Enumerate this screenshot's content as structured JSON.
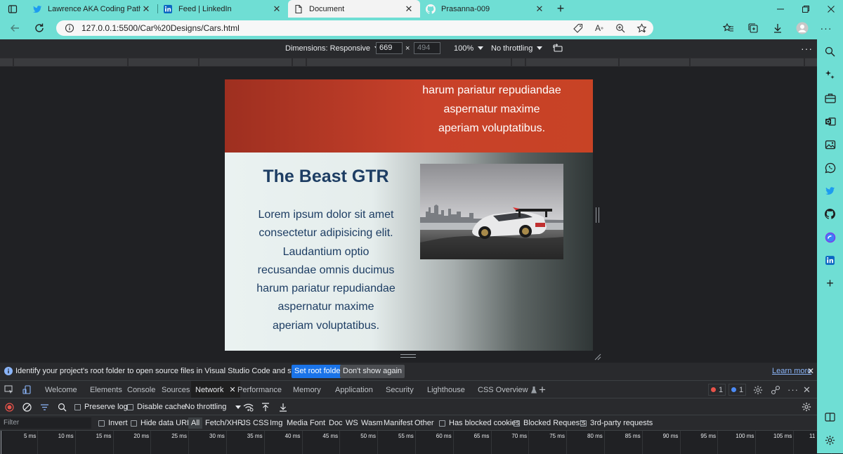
{
  "browser": {
    "tabs": [
      {
        "title": "Lawrence AKA Coding Paths (@L",
        "icon": "twitter-icon"
      },
      {
        "title": "Feed | LinkedIn",
        "icon": "linkedin-icon"
      },
      {
        "title": "Document",
        "icon": "document-icon",
        "active": true
      },
      {
        "title": "Prasanna-009",
        "icon": "github-icon"
      }
    ],
    "url": "127.0.0.1:5500/Car%20Designs/Cars.html",
    "accent_color": "#6fded4"
  },
  "device_toolbar": {
    "dimensions_label": "Dimensions: Responsive",
    "width": "669",
    "height": "494",
    "times": "×",
    "zoom": "100%",
    "throttling": "No throttling"
  },
  "page": {
    "red_section_lines": [
      "harum pariatur repudiandae",
      "aspernatur maxime",
      "aperiam voluptatibus."
    ],
    "gtr_title": "The Beast GTR",
    "gtr_lines": [
      "Lorem ipsum dolor sit amet",
      "consectetur adipisicing elit.",
      "Laudantium optio",
      "recusandae omnis ducimus",
      "harum pariatur repudiandae",
      "aspernatur maxime",
      "aperiam voluptatibus."
    ]
  },
  "infobar": {
    "message": "Identify your project's root folder to open source files in Visual Studio Code and sync changes.",
    "set_root": "Set root folder",
    "dont_show": "Don't show again",
    "learn_more": "Learn more"
  },
  "devtools": {
    "tabs": [
      "Welcome",
      "Elements",
      "Console",
      "Sources",
      "Network",
      "Performance",
      "Memory",
      "Application",
      "Security",
      "Lighthouse",
      "CSS Overview"
    ],
    "active_tab": "Network",
    "error_count": "1",
    "message_count": "1",
    "network": {
      "preserve_log": "Preserve log",
      "disable_cache": "Disable cache",
      "throttling": "No throttling",
      "filter_placeholder": "Filter",
      "invert": "Invert",
      "hide_data_urls": "Hide data URLs",
      "types": [
        "All",
        "Fetch/XHR",
        "JS",
        "CSS",
        "Img",
        "Media",
        "Font",
        "Doc",
        "WS",
        "Wasm",
        "Manifest",
        "Other"
      ],
      "has_blocked_cookies": "Has blocked cookies",
      "blocked_requests": "Blocked Requests",
      "third_party": "3rd-party requests",
      "timeline_ticks": [
        "5 ms",
        "10 ms",
        "15 ms",
        "20 ms",
        "25 ms",
        "30 ms",
        "35 ms",
        "40 ms",
        "45 ms",
        "50 ms",
        "55 ms",
        "60 ms",
        "65 ms",
        "70 ms",
        "75 ms",
        "80 ms",
        "85 ms",
        "90 ms",
        "95 ms",
        "100 ms",
        "105 ms",
        "11"
      ]
    }
  },
  "sidebar_icons": [
    "search-icon",
    "sparkle-icon",
    "briefcase-icon",
    "outlook-icon",
    "image-icon",
    "whatsapp-icon",
    "twitter-icon",
    "github-icon",
    "copilot-icon",
    "linkedin-icon",
    "add-icon"
  ]
}
